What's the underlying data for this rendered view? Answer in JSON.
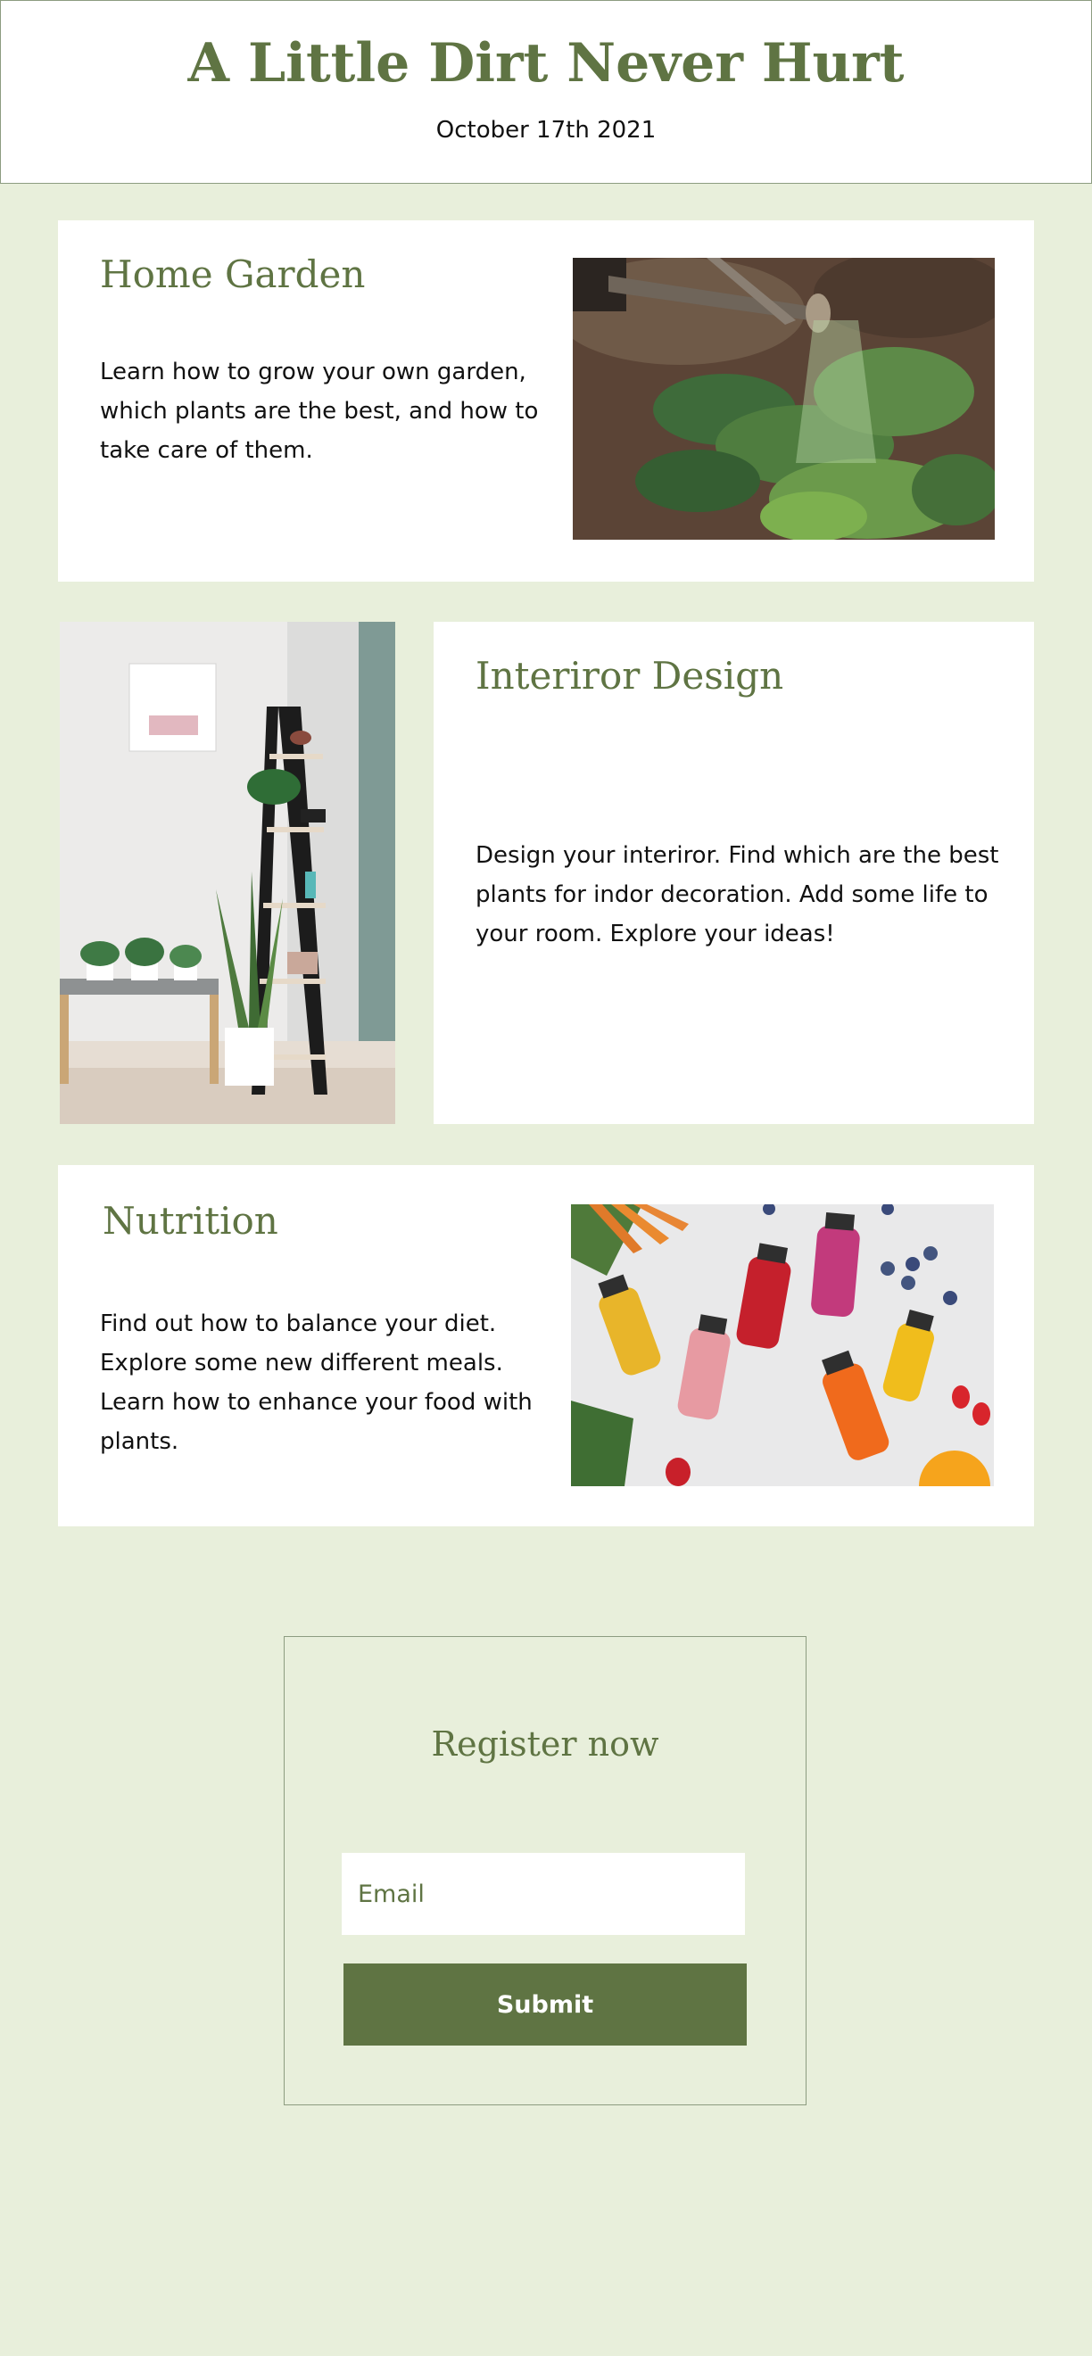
{
  "header": {
    "title": "A Little Dirt Never Hurt",
    "date": "October 17th 2021"
  },
  "cards": [
    {
      "title": "Home Garden",
      "text": "Learn how to grow your own garden, which plants are the best, and how to take care of them.",
      "image": "watering-garden-photo"
    },
    {
      "title": "Interiror Design",
      "text": "Design your interiror. Find which are the best plants for indor decoration. Add some life to your room. Explore your ideas!",
      "image": "plant-shelf-photo"
    },
    {
      "title": "Nutrition",
      "text": "Find out how to balance your diet. Explore some new different meals. Learn how to enhance your food with plants.",
      "image": "juice-bottles-photo"
    }
  ],
  "register": {
    "title": "Register now",
    "email_placeholder": "Email",
    "submit_label": "Submit"
  },
  "colors": {
    "page_background": "#e8efdb",
    "accent_green": "#5f7443",
    "card_background": "#ffffff"
  }
}
